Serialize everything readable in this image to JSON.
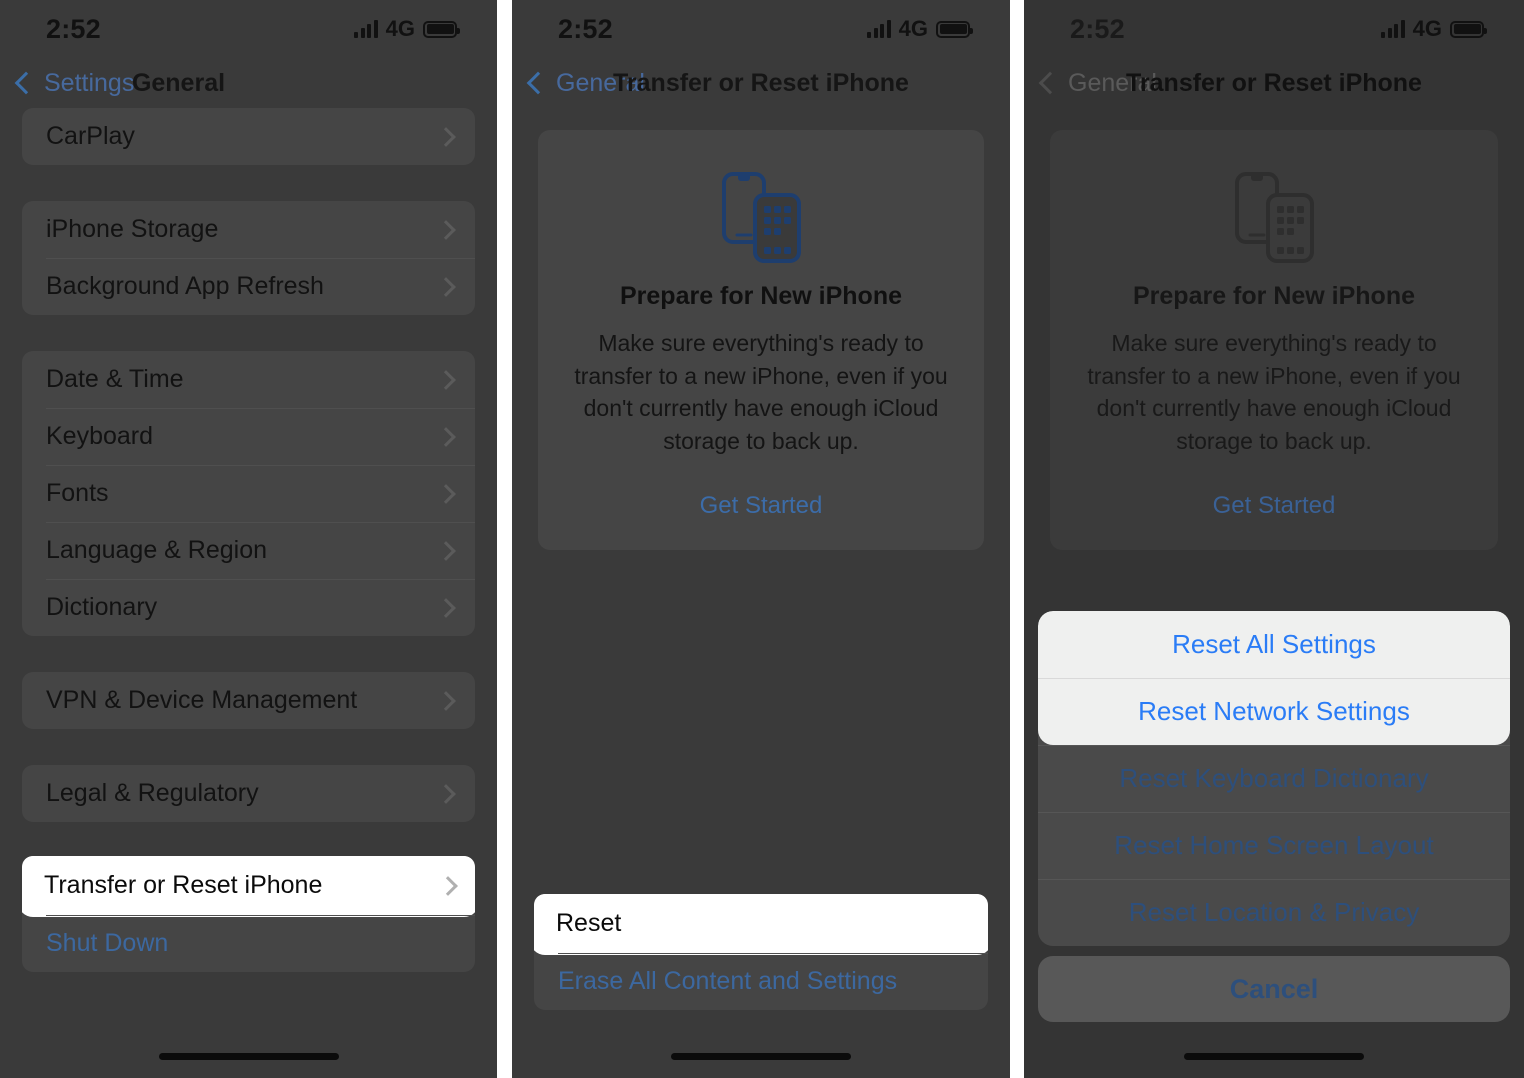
{
  "status_bar": {
    "time": "2:52",
    "network": "4G",
    "signal_icon": "cellular-signal-icon",
    "battery_icon": "battery-icon"
  },
  "panel_1": {
    "nav": {
      "back_label": "Settings",
      "back_icon": "chevron-left-icon",
      "title": "General"
    },
    "groups": [
      {
        "rows": [
          {
            "label": "CarPlay",
            "type": "nav"
          }
        ]
      },
      {
        "rows": [
          {
            "label": "iPhone Storage",
            "type": "nav"
          },
          {
            "label": "Background App Refresh",
            "type": "nav"
          }
        ]
      },
      {
        "rows": [
          {
            "label": "Date & Time",
            "type": "nav"
          },
          {
            "label": "Keyboard",
            "type": "nav"
          },
          {
            "label": "Fonts",
            "type": "nav"
          },
          {
            "label": "Language & Region",
            "type": "nav"
          },
          {
            "label": "Dictionary",
            "type": "nav"
          }
        ]
      },
      {
        "rows": [
          {
            "label": "VPN & Device Management",
            "type": "nav"
          }
        ]
      },
      {
        "rows": [
          {
            "label": "Legal & Regulatory",
            "type": "nav"
          }
        ]
      },
      {
        "rows": [
          {
            "label": "Transfer or Reset iPhone",
            "type": "nav",
            "highlighted": true
          },
          {
            "label": "Shut Down",
            "type": "link"
          }
        ]
      }
    ]
  },
  "panel_2": {
    "nav": {
      "back_label": "General",
      "back_icon": "chevron-left-icon",
      "title": "Transfer or Reset iPhone"
    },
    "card": {
      "icon": "two-iphones-icon",
      "title": "Prepare for New iPhone",
      "description": "Make sure everything's ready to transfer to a new iPhone, even if you don't currently have enough iCloud storage to back up.",
      "cta": "Get Started"
    },
    "bottom_rows": [
      {
        "label": "Reset",
        "highlighted": true
      },
      {
        "label": "Erase All Content and Settings",
        "highlighted": false
      }
    ]
  },
  "panel_3": {
    "nav": {
      "back_label": "General",
      "back_icon": "chevron-left-icon",
      "title": "Transfer or Reset iPhone"
    },
    "card": {
      "icon": "two-iphones-icon",
      "title": "Prepare for New iPhone",
      "description": "Make sure everything's ready to transfer to a new iPhone, even if you don't currently have enough iCloud storage to back up.",
      "cta": "Get Started"
    },
    "action_sheet": {
      "highlighted_options": [
        "Reset All Settings",
        "Reset Network Settings"
      ],
      "options": [
        "Reset Keyboard Dictionary",
        "Reset Home Screen Layout",
        "Reset Location & Privacy"
      ],
      "cancel_label": "Cancel"
    }
  },
  "colors": {
    "accent_blue": "#2a7cf6",
    "dim_blue": "#2d4f7c",
    "link_blue": "#3c68a0",
    "panel_bg": "#3a3a3a",
    "group_bg": "#454545",
    "highlight_white": "#ffffff",
    "sheet_highlight": "#eff0ef"
  }
}
